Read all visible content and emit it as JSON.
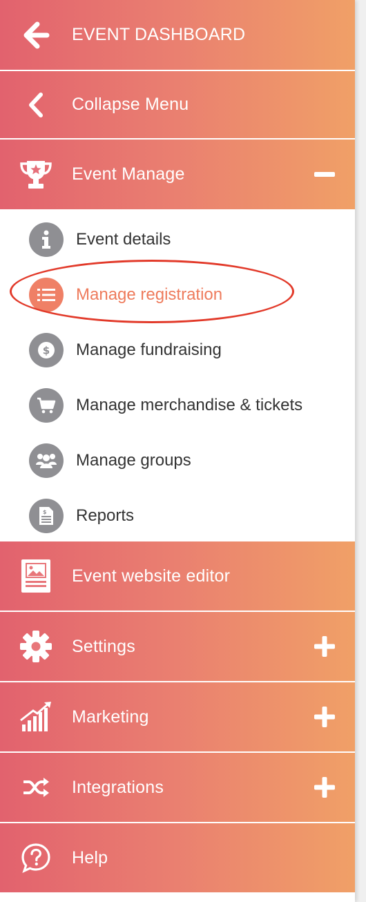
{
  "colors": {
    "gradient_start": "#e2626e",
    "gradient_end": "#f0a067",
    "active_orange": "#ef8066",
    "icon_gray": "#8f8f93",
    "highlight_red": "#e23a2a"
  },
  "top": [
    {
      "label": "EVENT DASHBOARD",
      "icon": "arrow-left-icon"
    },
    {
      "label": "Collapse Menu",
      "icon": "chevron-left-icon"
    },
    {
      "label": "Event Manage",
      "icon": "trophy-icon",
      "toggle": "minus-icon"
    }
  ],
  "sub": [
    {
      "label": "Event details",
      "icon": "info-icon"
    },
    {
      "label": "Manage registration",
      "icon": "list-icon",
      "active": true
    },
    {
      "label": "Manage fundraising",
      "icon": "dollar-icon"
    },
    {
      "label": "Manage merchandise & tickets",
      "icon": "cart-icon"
    },
    {
      "label": "Manage groups",
      "icon": "group-icon"
    },
    {
      "label": "Reports",
      "icon": "report-icon"
    }
  ],
  "bottom": [
    {
      "label": "Event website editor",
      "icon": "website-icon"
    },
    {
      "label": "Settings",
      "icon": "gear-icon",
      "toggle": "plus-icon"
    },
    {
      "label": "Marketing",
      "icon": "chart-icon",
      "toggle": "plus-icon"
    },
    {
      "label": "Integrations",
      "icon": "shuffle-icon",
      "toggle": "plus-icon"
    },
    {
      "label": "Help",
      "icon": "help-icon"
    }
  ]
}
